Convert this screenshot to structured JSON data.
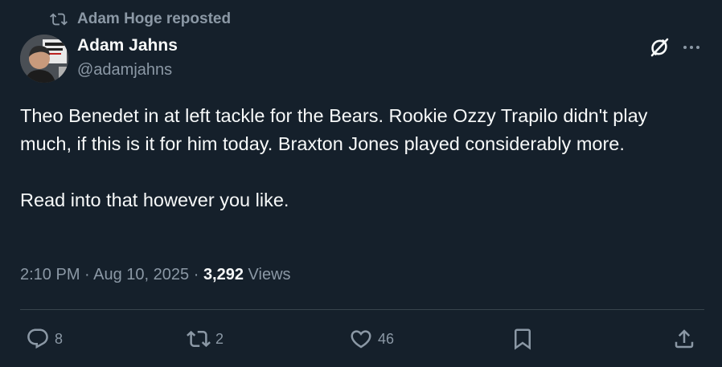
{
  "repost_bar": {
    "icon": "repost-icon",
    "text": "Adam Hoge reposted"
  },
  "author": {
    "name": "Adam Jahns",
    "handle": "@adamjahns",
    "avatar_icon": "avatar"
  },
  "header_actions": {
    "grok_icon": "grok-icon",
    "more_icon": "more-icon"
  },
  "tweet": {
    "paragraph_1": "Theo Benedet in at left tackle for the Bears. Rookie Ozzy Trapilo didn't play much, if this is it for him today. Braxton Jones played considerably more.",
    "paragraph_2": "Read into that however you like."
  },
  "meta": {
    "time": "2:10 PM",
    "sep1": " · ",
    "date": "Aug 10, 2025",
    "sep2": " · ",
    "views_count": "3,292",
    "views_label": " Views"
  },
  "actions": {
    "replies": {
      "icon": "reply-icon",
      "count": "8"
    },
    "reposts": {
      "icon": "repost-icon",
      "count": "2"
    },
    "likes": {
      "icon": "like-icon",
      "count": "46"
    },
    "bookmark": {
      "icon": "bookmark-icon"
    },
    "share": {
      "icon": "share-icon"
    }
  },
  "colors": {
    "background": "#15202b",
    "primary_text": "#f7f9f9",
    "secondary_text": "#8b98a5",
    "divider": "#38444d"
  }
}
